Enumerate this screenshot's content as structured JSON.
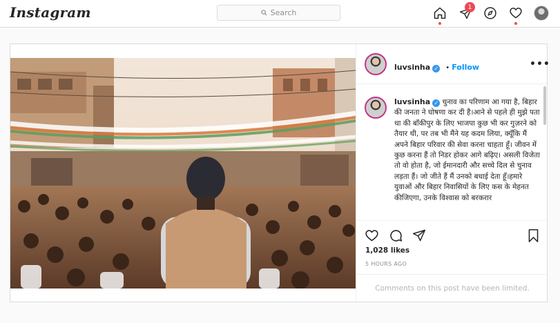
{
  "nav": {
    "logo": "Instagram",
    "search_placeholder": "Search",
    "notification_count": "1",
    "icons": [
      "home-icon",
      "direct-icon",
      "explore-icon",
      "heart-icon",
      "profile-avatar"
    ]
  },
  "post": {
    "username": "luvsinha",
    "verified": true,
    "follow_label": "Follow",
    "more_label": "•••",
    "caption": "चुनाव का परिणाम आ गया है, बिहार की जनता ने घोषणा कर दी है।आने से पहले ही मुझे पता था की बाँकीपुर के लिए भाजपा कुछ भी कर गुज़रने को तैयार थी, पर तब भी मैंने यह कदम लिया, क्यूँकि मैं अपने बिहार परिवार की सेवा करना चाहता हूँ। जीवन में कुछ करना हैं तो निडर होकर आगे बढ़िए। असली विजेता तो वो होता है, जो ईमानदारी और सच्चे दिल से चुनाव लड़ता हैं। जो जीते हैं मैं उनको बधाई देता हूँ।हमारे युवाओं और बिहार निवासियों के लिए कस के मेहनत कीजिएगा, उनके विश्वास को बरकरार",
    "likes": "1,028 likes",
    "time_ago": "5 HOURS AGO",
    "comments_limited": "Comments on this post have been limited."
  },
  "colors": {
    "accent": "#0095f6",
    "notification": "#ed4956",
    "border": "#dbdbdb"
  }
}
